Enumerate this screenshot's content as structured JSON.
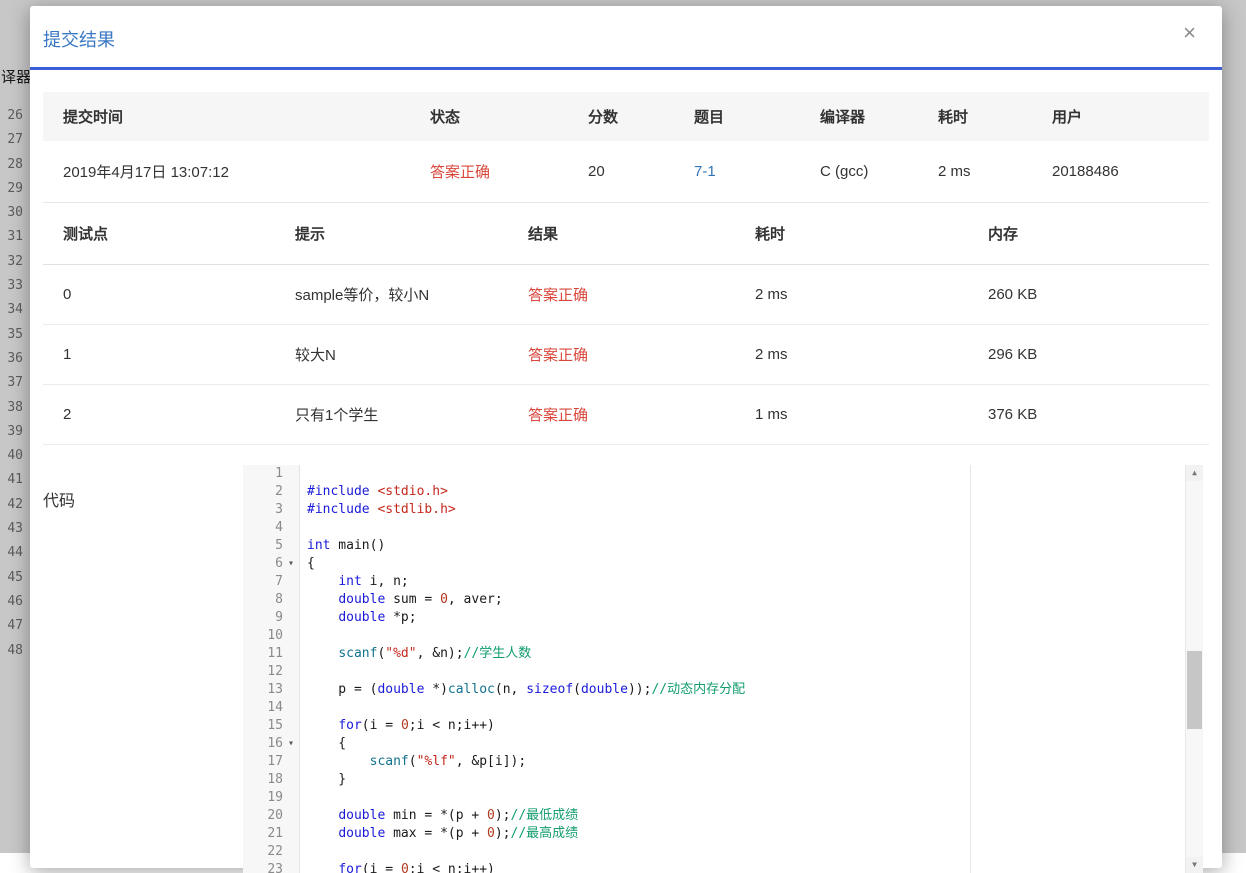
{
  "background": {
    "partial_label": "译器",
    "line_numbers": [
      "26",
      "27",
      "28",
      "29",
      "30",
      "31",
      "32",
      "33",
      "34",
      "35",
      "36",
      "37",
      "38",
      "39",
      "40",
      "41",
      "42",
      "43",
      "44",
      "45",
      "46",
      "47",
      "48"
    ]
  },
  "modal": {
    "title": "提交结果",
    "close_icon": "×"
  },
  "summary_table": {
    "headers": [
      "提交时间",
      "状态",
      "分数",
      "题目",
      "编译器",
      "耗时",
      "用户"
    ],
    "row": {
      "time": "2019年4月17日 13:07:12",
      "status": "答案正确",
      "score": "20",
      "problem": "7-1",
      "compiler": "C (gcc)",
      "duration": "2 ms",
      "user": "20188486"
    }
  },
  "tests_table": {
    "headers": [
      "测试点",
      "提示",
      "结果",
      "耗时",
      "内存"
    ],
    "rows": [
      {
        "id": "0",
        "hint": "sample等价，较小N",
        "result": "答案正确",
        "time": "2 ms",
        "memory": "260 KB"
      },
      {
        "id": "1",
        "hint": "较大N",
        "result": "答案正确",
        "time": "2 ms",
        "memory": "296 KB"
      },
      {
        "id": "2",
        "hint": "只有1个学生",
        "result": "答案正确",
        "time": "1 ms",
        "memory": "376 KB"
      }
    ]
  },
  "code_section": {
    "label": "代码",
    "fold_icon": "▾",
    "fold_markers": [
      6,
      16
    ],
    "lines": [
      [],
      [
        [
          "kw",
          "#include"
        ],
        [
          "pl",
          " "
        ],
        [
          "str",
          "<stdio.h>"
        ]
      ],
      [
        [
          "kw",
          "#include"
        ],
        [
          "pl",
          " "
        ],
        [
          "str",
          "<stdlib.h>"
        ]
      ],
      [],
      [
        [
          "kw",
          "int"
        ],
        [
          "pl",
          " main()"
        ]
      ],
      [
        [
          "pl",
          "{"
        ]
      ],
      [
        [
          "pl",
          "    "
        ],
        [
          "kw",
          "int"
        ],
        [
          "pl",
          " i, n;"
        ]
      ],
      [
        [
          "pl",
          "    "
        ],
        [
          "kw",
          "double"
        ],
        [
          "pl",
          " sum = "
        ],
        [
          "num",
          "0"
        ],
        [
          "pl",
          ", aver;"
        ]
      ],
      [
        [
          "pl",
          "    "
        ],
        [
          "kw",
          "double"
        ],
        [
          "pl",
          " *p;"
        ]
      ],
      [],
      [
        [
          "pl",
          "    "
        ],
        [
          "fn",
          "scanf"
        ],
        [
          "pl",
          "("
        ],
        [
          "str",
          "\"%d\""
        ],
        [
          "pl",
          ", &n);"
        ],
        [
          "com",
          "//学生人数"
        ]
      ],
      [],
      [
        [
          "pl",
          "    p = ("
        ],
        [
          "kw",
          "double"
        ],
        [
          "pl",
          " *)"
        ],
        [
          "fn",
          "calloc"
        ],
        [
          "pl",
          "(n, "
        ],
        [
          "kw",
          "sizeof"
        ],
        [
          "pl",
          "("
        ],
        [
          "kw",
          "double"
        ],
        [
          "pl",
          "));"
        ],
        [
          "com",
          "//动态内存分配"
        ]
      ],
      [],
      [
        [
          "pl",
          "    "
        ],
        [
          "kw",
          "for"
        ],
        [
          "pl",
          "(i = "
        ],
        [
          "num",
          "0"
        ],
        [
          "pl",
          ";i < n;i++)"
        ]
      ],
      [
        [
          "pl",
          "    {"
        ]
      ],
      [
        [
          "pl",
          "        "
        ],
        [
          "fn",
          "scanf"
        ],
        [
          "pl",
          "("
        ],
        [
          "str",
          "\"%lf\""
        ],
        [
          "pl",
          ", &p[i]);"
        ]
      ],
      [
        [
          "pl",
          "    }"
        ]
      ],
      [],
      [
        [
          "pl",
          "    "
        ],
        [
          "kw",
          "double"
        ],
        [
          "pl",
          " min = *(p + "
        ],
        [
          "num",
          "0"
        ],
        [
          "pl",
          ");"
        ],
        [
          "com",
          "//最低成绩"
        ]
      ],
      [
        [
          "pl",
          "    "
        ],
        [
          "kw",
          "double"
        ],
        [
          "pl",
          " max = *(p + "
        ],
        [
          "num",
          "0"
        ],
        [
          "pl",
          ");"
        ],
        [
          "com",
          "//最高成绩"
        ]
      ],
      [],
      [
        [
          "pl",
          "    "
        ],
        [
          "kw",
          "for"
        ],
        [
          "pl",
          "(i = "
        ],
        [
          "num",
          "0"
        ],
        [
          "pl",
          ";i < n;i++)"
        ]
      ]
    ]
  },
  "scrollbar": {
    "up_icon": "▲",
    "down_icon": "▼"
  },
  "colors": {
    "title_blue": "#3b78c3",
    "divider_blue": "#3c5cd8",
    "status_red": "#d9473b",
    "link_blue": "#3374b5",
    "header_bg": "#f6f6f7",
    "syntax_keyword": "#1a1ada",
    "syntax_string": "#c5281c",
    "syntax_number": "#b03a1e",
    "syntax_comment": "#129d6e",
    "syntax_function": "#13738f"
  }
}
